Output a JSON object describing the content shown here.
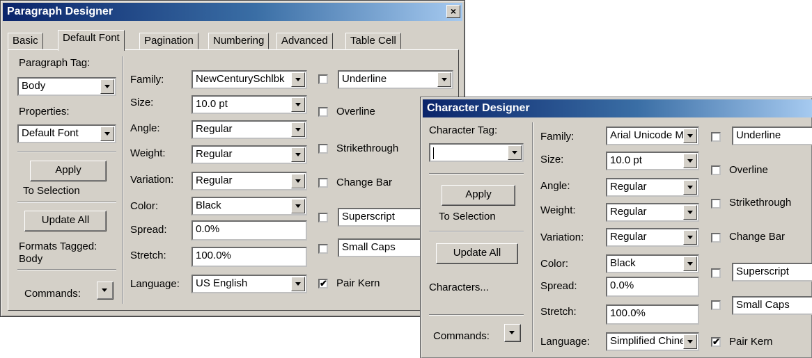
{
  "paragraph_designer": {
    "title": "Paragraph Designer",
    "close": "×",
    "tabs": [
      "Basic",
      "Default Font",
      "Pagination",
      "Numbering",
      "Advanced",
      "Table Cell"
    ],
    "active_tab": "Default Font",
    "tag_label": "Paragraph Tag:",
    "tag_value": "Body",
    "properties_label": "Properties:",
    "properties_value": "Default Font",
    "apply": "Apply",
    "to_selection": "To Selection",
    "update_all": "Update All",
    "formats_tagged": "Formats Tagged:",
    "formats_tagged_value": "Body",
    "commands": "Commands:",
    "fields": {
      "family_label": "Family:",
      "family": "NewCenturySchlbk",
      "size_label": "Size:",
      "size": "10.0 pt",
      "angle_label": "Angle:",
      "angle": "Regular",
      "weight_label": "Weight:",
      "weight": "Regular",
      "variation_label": "Variation:",
      "variation": "Regular",
      "color_label": "Color:",
      "color": "Black",
      "spread_label": "Spread:",
      "spread": "0.0%",
      "stretch_label": "Stretch:",
      "stretch": "100.0%",
      "language_label": "Language:",
      "language": "US English"
    },
    "checks": {
      "underline": "Underline",
      "overline": "Overline",
      "strikethrough": "Strikethrough",
      "change_bar": "Change Bar",
      "superscript": "Superscript",
      "small_caps": "Small Caps",
      "pair_kern": "Pair Kern",
      "check_mark": "✔"
    }
  },
  "character_designer": {
    "title": "Character Designer",
    "tag_label": "Character Tag:",
    "tag_value": "",
    "apply": "Apply",
    "to_selection": "To Selection",
    "update_all": "Update All",
    "characters": "Characters...",
    "commands": "Commands:",
    "fields": {
      "family_label": "Family:",
      "family": "Arial Unicode MS",
      "size_label": "Size:",
      "size": "10.0 pt",
      "angle_label": "Angle:",
      "angle": "Regular",
      "weight_label": "Weight:",
      "weight": "Regular",
      "variation_label": "Variation:",
      "variation": "Regular",
      "color_label": "Color:",
      "color": "Black",
      "spread_label": "Spread:",
      "spread": "0.0%",
      "stretch_label": "Stretch:",
      "stretch": "100.0%",
      "language_label": "Language:",
      "language": "Simplified Chinese"
    },
    "checks": {
      "underline": "Underline",
      "overline": "Overline",
      "strikethrough": "Strikethrough",
      "change_bar": "Change Bar",
      "superscript": "Superscript",
      "small_caps": "Small Caps",
      "pair_kern": "Pair Kern",
      "check_mark": "✔"
    }
  }
}
